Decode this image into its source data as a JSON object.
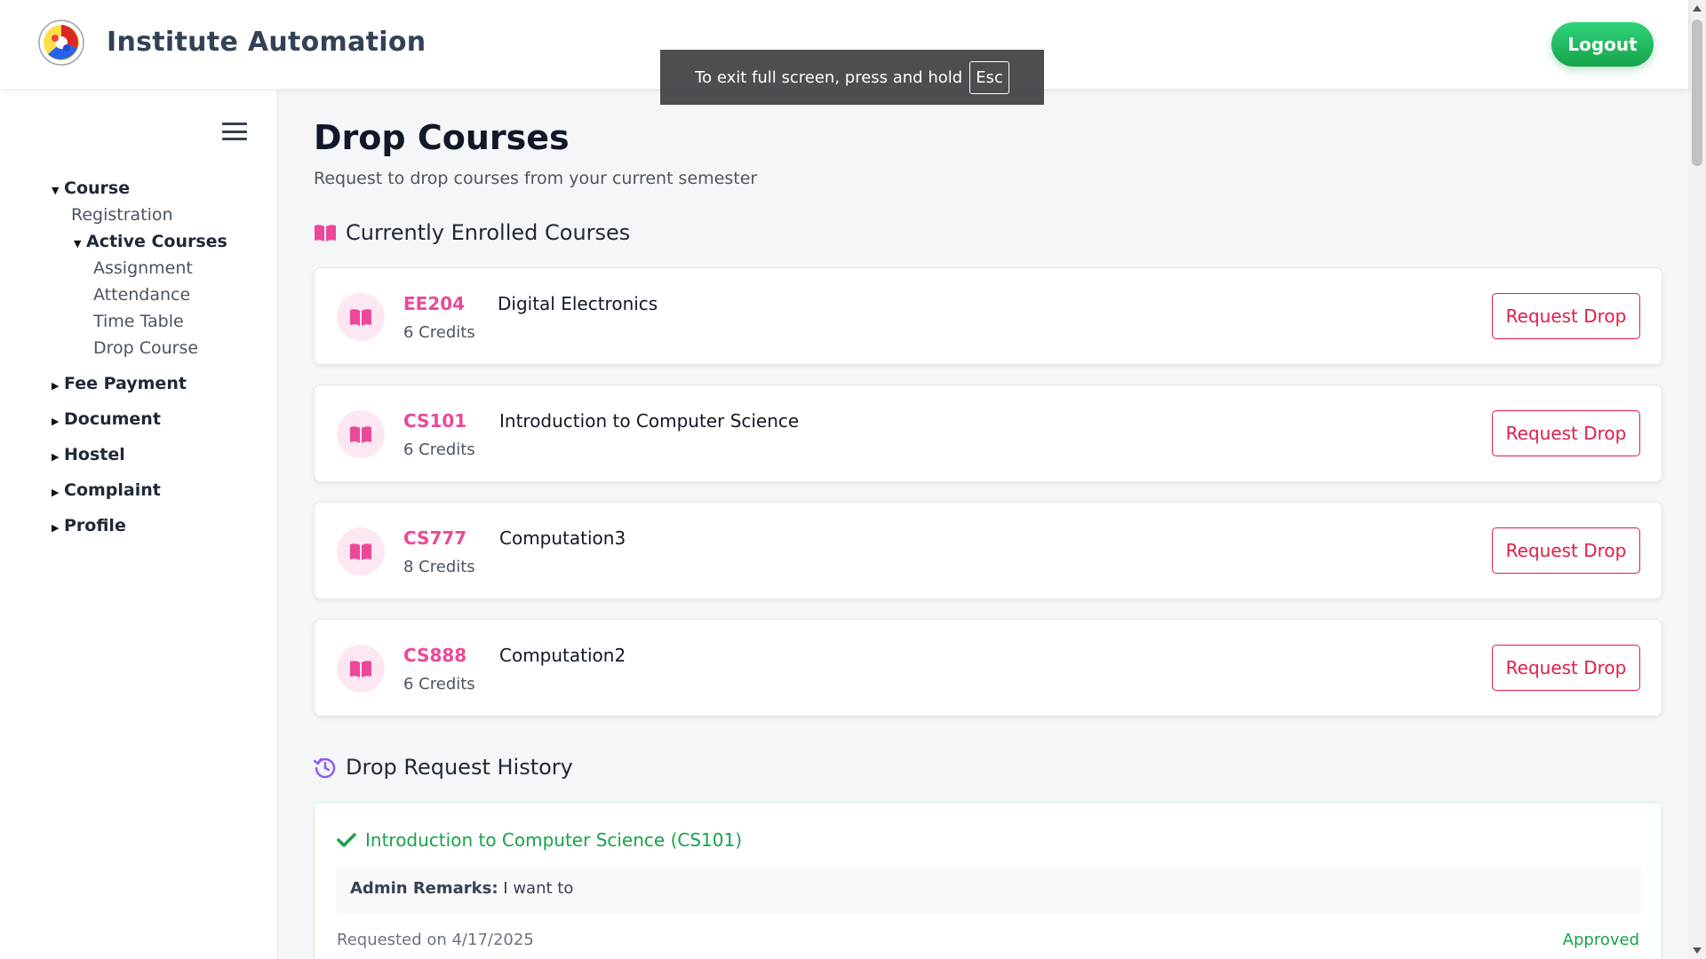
{
  "header": {
    "title": "Institute Automation",
    "logout_label": "Logout"
  },
  "fullscreen_toast": {
    "text": "To exit full screen, press and hold",
    "key": "Esc"
  },
  "sidebar": {
    "course": "Course",
    "registration": "Registration",
    "active_courses": "Active Courses",
    "assignment": "Assignment",
    "attendance": "Attendance",
    "time_table": "Time Table",
    "drop_course": "Drop Course",
    "fee_payment": "Fee Payment",
    "document": "Document",
    "hostel": "Hostel",
    "complaint": "Complaint",
    "profile": "Profile"
  },
  "main": {
    "title": "Drop Courses",
    "subtitle": "Request to drop courses from your current semester",
    "enrolled_heading": "Currently Enrolled Courses",
    "history_heading": "Drop Request History",
    "courses": [
      {
        "code": "EE204",
        "name": "Digital Electronics",
        "credits": "6 Credits",
        "action": "Request Drop"
      },
      {
        "code": "CS101",
        "name": "Introduction to Computer Science",
        "credits": "6 Credits",
        "action": "Request Drop"
      },
      {
        "code": "CS777",
        "name": "Computation3",
        "credits": "8 Credits",
        "action": "Request Drop"
      },
      {
        "code": "CS888",
        "name": "Computation2",
        "credits": "6 Credits",
        "action": "Request Drop"
      }
    ],
    "history": [
      {
        "title": "Introduction to Computer Science (CS101)",
        "remarks_label": "Admin Remarks:",
        "remarks": "I want to",
        "requested_on": "Requested on 4/17/2025",
        "status": "Approved"
      }
    ]
  },
  "colors": {
    "accent_pink": "#ec4899",
    "drop_red": "#e11d48",
    "success_green": "#16a34a",
    "history_purple": "#8b5cf6"
  }
}
